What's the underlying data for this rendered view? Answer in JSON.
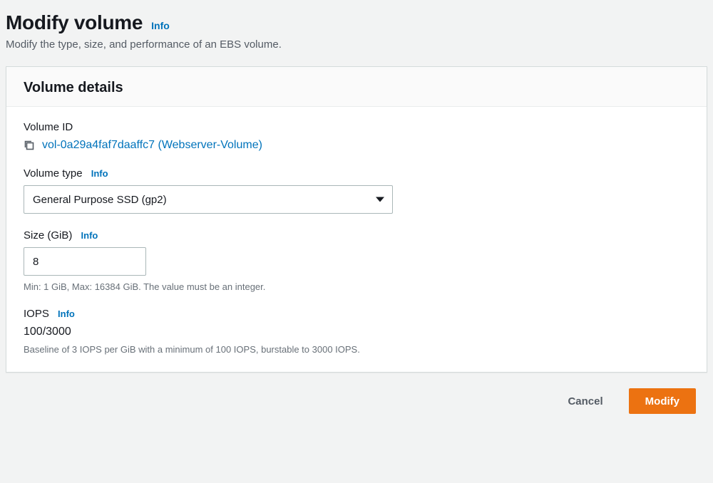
{
  "header": {
    "title": "Modify volume",
    "info": "Info",
    "description": "Modify the type, size, and performance of an EBS volume."
  },
  "panel": {
    "title": "Volume details",
    "volumeId": {
      "label": "Volume ID",
      "value": "vol-0a29a4faf7daaffc7 (Webserver-Volume)"
    },
    "volumeType": {
      "label": "Volume type",
      "info": "Info",
      "selected": "General Purpose SSD (gp2)"
    },
    "size": {
      "label": "Size (GiB)",
      "info": "Info",
      "value": "8",
      "hint": "Min: 1 GiB, Max: 16384 GiB. The value must be an integer."
    },
    "iops": {
      "label": "IOPS",
      "info": "Info",
      "value": "100/3000",
      "hint": "Baseline of 3 IOPS per GiB with a minimum of 100 IOPS, burstable to 3000 IOPS."
    }
  },
  "footer": {
    "cancel": "Cancel",
    "modify": "Modify"
  }
}
